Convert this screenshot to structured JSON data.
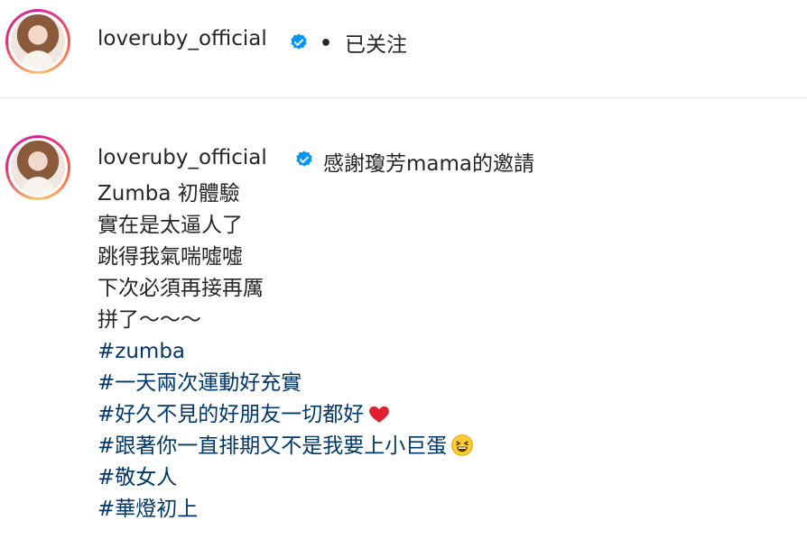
{
  "header": {
    "username": "loveruby_official",
    "separator": "•",
    "follow_status": "已关注"
  },
  "caption": {
    "username": "loveruby_official",
    "first_line": "感謝瓊芳mama的邀請",
    "lines": [
      {
        "text": "Zumba 初體驗",
        "type": "text"
      },
      {
        "text": "實在是太逼人了",
        "type": "text"
      },
      {
        "text": "跳得我氣喘噓噓",
        "type": "text"
      },
      {
        "text": "下次必須再接再厲",
        "type": "text"
      },
      {
        "text": "拼了～～～",
        "type": "text"
      },
      {
        "text": "#zumba",
        "type": "hashtag"
      },
      {
        "text": "#一天兩次運動好充實",
        "type": "hashtag"
      },
      {
        "text": "#好久不見的好朋友一切都好",
        "type": "hashtag",
        "emoji": "red-heart-icon"
      },
      {
        "text": "#跟著你一直排期又不是我要上小巨蛋",
        "type": "hashtag",
        "emoji": "laughing-face-icon"
      },
      {
        "text": "#敬女人",
        "type": "hashtag"
      },
      {
        "text": "#華燈初上",
        "type": "hashtag"
      }
    ]
  },
  "colors": {
    "text": "#262626",
    "hashtag": "#00376b",
    "verified": "#0095f6",
    "divider": "#ececec"
  }
}
